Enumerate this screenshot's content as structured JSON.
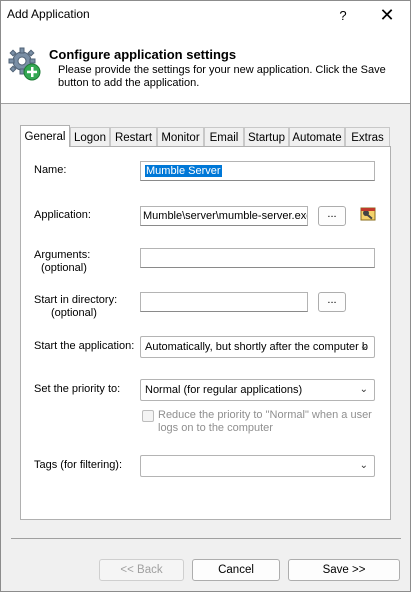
{
  "window": {
    "title": "Add Application",
    "help_glyph": "?",
    "close_glyph": "✕"
  },
  "banner": {
    "title": "Configure application settings",
    "description": "Please provide the settings for your new application. Click the Save button to add the application.",
    "icon": "gear-add-icon"
  },
  "tabs": [
    {
      "label": "General",
      "active": true
    },
    {
      "label": "Logon"
    },
    {
      "label": "Restart"
    },
    {
      "label": "Monitor"
    },
    {
      "label": "Email"
    },
    {
      "label": "Startup"
    },
    {
      "label": "Automate"
    },
    {
      "label": "Extras"
    }
  ],
  "form": {
    "name_label": "Name:",
    "name_value": "Mumble Server",
    "application_label": "Application:",
    "application_value": "Mumble\\server\\mumble-server.exe",
    "browse_label": "...",
    "arguments_label": "Arguments:",
    "arguments_sub": "(optional)",
    "arguments_value": "",
    "start_dir_label": "Start in directory:",
    "start_dir_sub": "(optional)",
    "start_dir_value": "",
    "start_app_label": "Start the application:",
    "start_app_value": "Automatically, but shortly after the computer b",
    "priority_label": "Set the priority to:",
    "priority_value": "Normal (for regular applications)",
    "reduce_priority_text": "Reduce the priority to \"Normal\" when a user logs on to the computer",
    "reduce_priority_checked": false,
    "tags_label": "Tags (for filtering):",
    "tags_value": ""
  },
  "buttons": {
    "back": "<< Back",
    "cancel": "Cancel",
    "save": "Save >>"
  }
}
